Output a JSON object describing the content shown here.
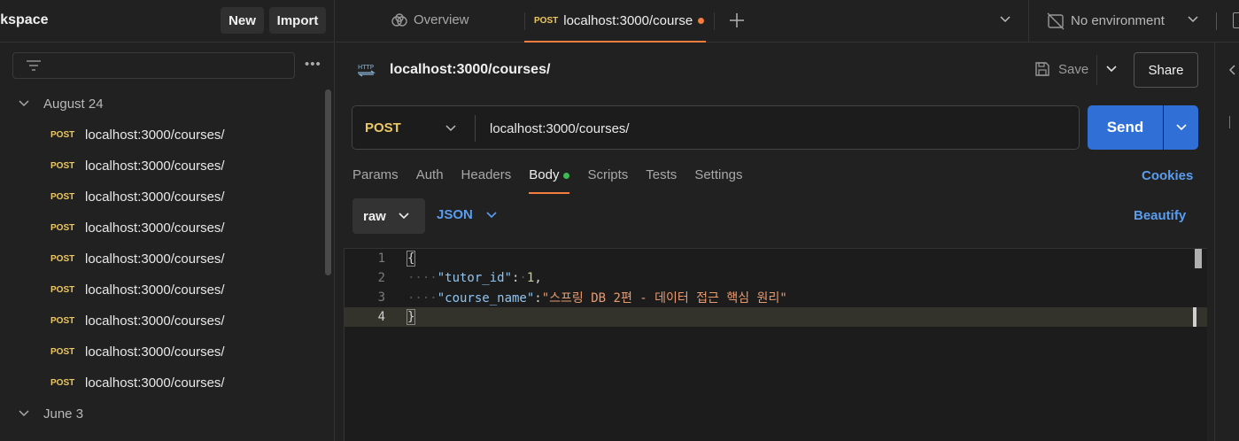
{
  "sidebar": {
    "workspace_title": "rkspace",
    "new_label": "New",
    "import_label": "Import",
    "groups": [
      {
        "label": "August 24"
      },
      {
        "label": "June 3"
      }
    ],
    "requests": [
      {
        "method": "POST",
        "url": "localhost:3000/courses/"
      },
      {
        "method": "POST",
        "url": "localhost:3000/courses/"
      },
      {
        "method": "POST",
        "url": "localhost:3000/courses/"
      },
      {
        "method": "POST",
        "url": "localhost:3000/courses/"
      },
      {
        "method": "POST",
        "url": "localhost:3000/courses/"
      },
      {
        "method": "POST",
        "url": "localhost:3000/courses/"
      },
      {
        "method": "POST",
        "url": "localhost:3000/courses/"
      },
      {
        "method": "POST",
        "url": "localhost:3000/courses/"
      },
      {
        "method": "POST",
        "url": "localhost:3000/courses/"
      }
    ]
  },
  "tabs": {
    "overview_label": "Overview",
    "active_method": "POST",
    "active_url": "localhost:3000/course"
  },
  "environment": {
    "label": "No environment"
  },
  "request": {
    "title": "localhost:3000/courses/",
    "save_label": "Save",
    "share_label": "Share",
    "method": "POST",
    "url": "localhost:3000/courses/",
    "send_label": "Send"
  },
  "subtabs": {
    "items": [
      "Params",
      "Auth",
      "Headers",
      "Body",
      "Scripts",
      "Tests",
      "Settings"
    ],
    "active": "Body",
    "cookies_label": "Cookies"
  },
  "body_options": {
    "mode": "raw",
    "format": "JSON",
    "beautify_label": "Beautify"
  },
  "editor": {
    "line_numbers": [
      "1",
      "2",
      "3",
      "4"
    ],
    "open_brace": "{",
    "close_brace": "}",
    "tutor_key": "\"tutor_id\"",
    "tutor_value": "1",
    "course_key": "\"course_name\"",
    "course_value": "\"스프링 DB 2편 - 데이터 접근 핵심 원리\""
  },
  "colors": {
    "accent_orange": "#f37c3f",
    "send_blue": "#2f6fd6",
    "method_yellow": "#ecc864",
    "link_blue": "#5a9df0"
  }
}
